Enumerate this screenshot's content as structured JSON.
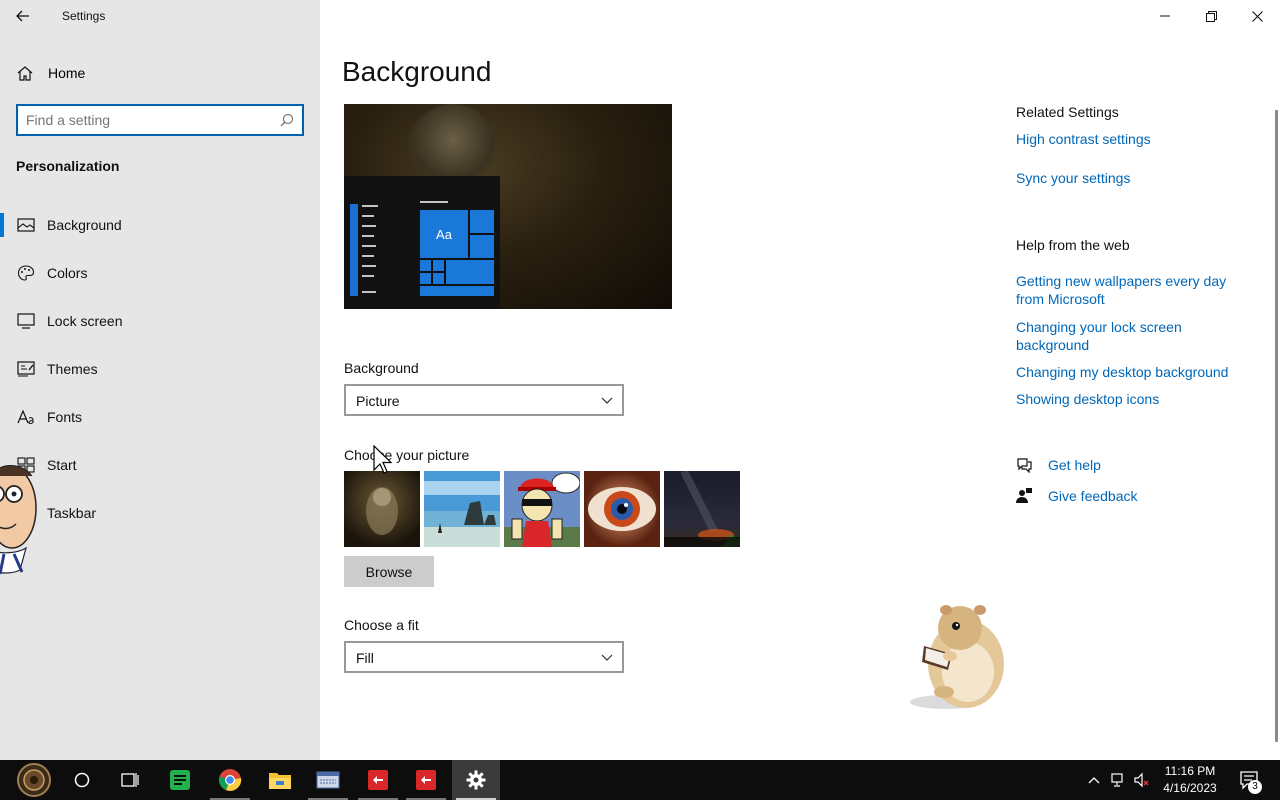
{
  "window": {
    "title": "Settings",
    "back_icon": "back-arrow-icon",
    "caption": {
      "minimize_icon": "minimize-icon",
      "restore_icon": "restore-icon",
      "close_icon": "close-icon"
    }
  },
  "sidebar": {
    "home_label": "Home",
    "search_placeholder": "Find a setting",
    "section": "Personalization",
    "items": [
      {
        "label": "Background",
        "icon": "picture-icon",
        "active": true
      },
      {
        "label": "Colors",
        "icon": "palette-icon"
      },
      {
        "label": "Lock screen",
        "icon": "lock-screen-icon"
      },
      {
        "label": "Themes",
        "icon": "themes-icon"
      },
      {
        "label": "Fonts",
        "icon": "fonts-icon"
      },
      {
        "label": "Start",
        "icon": "start-icon"
      },
      {
        "label": "Taskbar",
        "icon": "taskbar-icon"
      }
    ]
  },
  "main": {
    "title": "Background",
    "preview_tile_text": "Aa",
    "background_label": "Background",
    "background_value": "Picture",
    "choose_picture_label": "Choose your picture",
    "thumbnails": [
      "ghost-creature-thumbnail",
      "beach-rock-thumbnail",
      "cartoon-character-thumbnail",
      "eye-closeup-thumbnail",
      "night-sky-thumbnail"
    ],
    "browse_label": "Browse",
    "fit_label": "Choose a fit",
    "fit_value": "Fill"
  },
  "related": {
    "heading": "Related Settings",
    "links": [
      "High contrast settings",
      "Sync your settings"
    ]
  },
  "help_web": {
    "heading": "Help from the web",
    "links": [
      "Getting new wallpapers every day from Microsoft",
      "Changing your lock screen background",
      "Changing my desktop background",
      "Showing desktop icons"
    ]
  },
  "support": {
    "get_help": "Get help",
    "give_feedback": "Give feedback"
  },
  "taskbar": {
    "time": "11:16 PM",
    "date": "4/16/2023",
    "notification_count": "3",
    "accent": "#0078d7"
  }
}
